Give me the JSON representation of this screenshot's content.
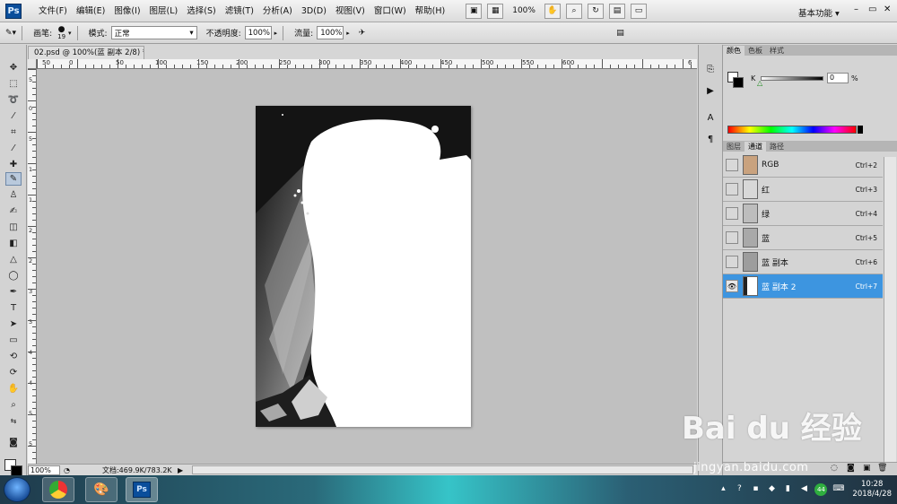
{
  "app": {
    "logo": "Ps",
    "workspace": "基本功能",
    "workspace_arrow": "▾"
  },
  "menu": [
    "文件(F)",
    "编辑(E)",
    "图像(I)",
    "图层(L)",
    "选择(S)",
    "滤镜(T)",
    "分析(A)",
    "3D(D)",
    "视图(V)",
    "窗口(W)",
    "帮助(H)"
  ],
  "menu_zoom": "100%",
  "window_controls": {
    "minimize": "–",
    "restore": "▭",
    "close": "✕"
  },
  "options": {
    "brush_label": "画笔:",
    "brush_size": "19",
    "mode_label": "模式:",
    "mode_value": "正常",
    "opacity_label": "不透明度:",
    "opacity_value": "100%",
    "flow_label": "流量:",
    "flow_value": "100%"
  },
  "document": {
    "tab_title": "02.psd @ 100%(蓝 副本 2/8) *",
    "tab_close": "×",
    "ruler_h_labels": [
      "50",
      "0",
      "50",
      "100",
      "150",
      "200",
      "250",
      "300",
      "350",
      "400",
      "450",
      "500",
      "550",
      "600",
      "6"
    ],
    "ruler_v_labels": [
      "5",
      "0",
      "5",
      "1",
      "1",
      "2",
      "2",
      "3",
      "3",
      "4",
      "4",
      "5",
      "5"
    ]
  },
  "status": {
    "zoom": "100%",
    "doc_info": "文档:469.9K/783.2K",
    "arrow": "▶"
  },
  "panels": {
    "color_tabs": [
      "颜色",
      "色板",
      "样式"
    ],
    "color_channel_label": "K",
    "color_value": "0",
    "color_unit": "%",
    "layer_tabs": [
      "图层",
      "通道",
      "路径"
    ],
    "channels": [
      {
        "name": "RGB",
        "shortcut": "Ctrl+2",
        "visible": false
      },
      {
        "name": "红",
        "shortcut": "Ctrl+3",
        "visible": false
      },
      {
        "name": "绿",
        "shortcut": "Ctrl+4",
        "visible": false
      },
      {
        "name": "蓝",
        "shortcut": "Ctrl+5",
        "visible": false
      },
      {
        "name": "蓝 副本",
        "shortcut": "Ctrl+6",
        "visible": false
      },
      {
        "name": "蓝 副本 2",
        "shortcut": "Ctrl+7",
        "visible": true
      }
    ]
  },
  "taskbar": {
    "ps_label": "Ps",
    "tray_badge": "44",
    "time": "10:28",
    "date": "2018/4/28"
  },
  "watermark": {
    "main": "Bai du 经验",
    "sub": "jingyan.baidu.com"
  },
  "colors": {
    "selected_row": "#3d95e0",
    "ps_blue": "#0a4e9b"
  }
}
